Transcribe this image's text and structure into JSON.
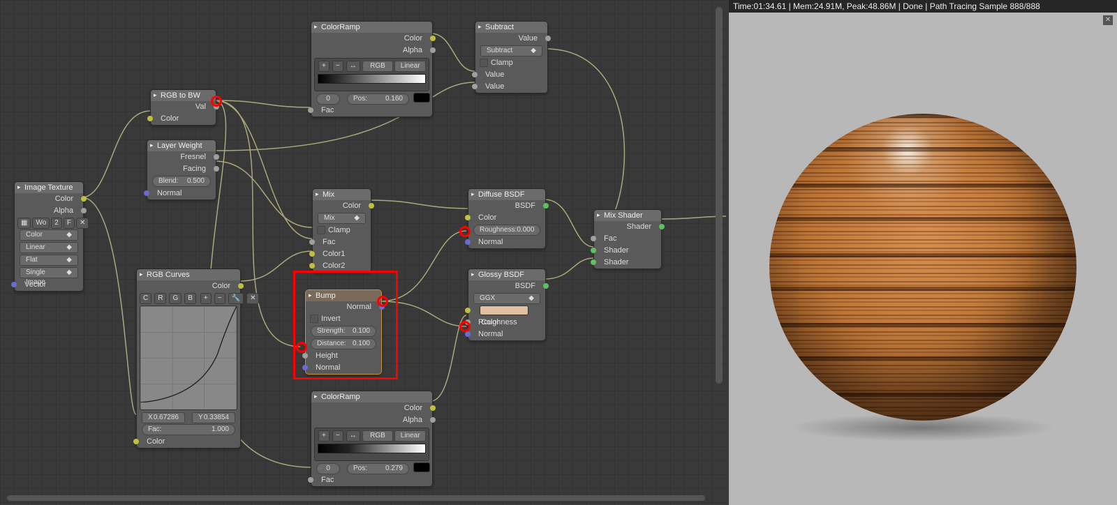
{
  "status": "Time:01:34.61 | Mem:24.91M, Peak:48.86M | Done | Path Tracing Sample 888/888",
  "imageTexture": {
    "title": "Image Texture",
    "outColor": "Color",
    "outAlpha": "Alpha",
    "imgName": "Wo",
    "btn2": "2",
    "btnF": "F",
    "colorSpace": "Color",
    "interp": "Linear",
    "proj": "Flat",
    "frame": "Single Image",
    "inVector": "Vector"
  },
  "rgbToBw": {
    "title": "RGB to BW",
    "outVal": "Val",
    "inColor": "Color"
  },
  "layerWeight": {
    "title": "Layer Weight",
    "outFresnel": "Fresnel",
    "outFacing": "Facing",
    "blendLabel": "Blend:",
    "blendVal": "0.500",
    "inNormal": "Normal"
  },
  "rgbCurves": {
    "title": "RGB Curves",
    "outColor": "Color",
    "tabs": {
      "c": "C",
      "r": "R",
      "g": "G",
      "b": "B"
    },
    "xLabel": "X",
    "xVal": "0.67286",
    "yLabel": "Y",
    "yVal": "0.33854",
    "facLabel": "Fac:",
    "facVal": "1.000",
    "inColor": "Color"
  },
  "colorRamp1": {
    "title": "ColorRamp",
    "outColor": "Color",
    "outAlpha": "Alpha",
    "mode": "RGB",
    "interp": "Linear",
    "stop": "0",
    "posLabel": "Pos:",
    "posVal": "0.160",
    "inFac": "Fac"
  },
  "colorRamp2": {
    "title": "ColorRamp",
    "outColor": "Color",
    "outAlpha": "Alpha",
    "mode": "RGB",
    "interp": "Linear",
    "stop": "0",
    "posLabel": "Pos:",
    "posVal": "0.279",
    "inFac": "Fac"
  },
  "subtract": {
    "title": "Subtract",
    "outValue": "Value",
    "op": "Subtract",
    "clamp": "Clamp",
    "inVal1": "Value",
    "inVal2": "Value"
  },
  "mix": {
    "title": "Mix",
    "outColor": "Color",
    "mode": "Mix",
    "clamp": "Clamp",
    "inFac": "Fac",
    "inColor1": "Color1",
    "inColor2": "Color2"
  },
  "bump": {
    "title": "Bump",
    "outNormal": "Normal",
    "invert": "Invert",
    "strLabel": "Strength:",
    "strVal": "0.100",
    "distLabel": "Distance:",
    "distVal": "0.100",
    "inHeight": "Height",
    "inNormal": "Normal"
  },
  "diffuse": {
    "title": "Diffuse BSDF",
    "outBSDF": "BSDF",
    "inColor": "Color",
    "roughLabel": "Roughness:",
    "roughVal": "0.000",
    "inNormal": "Normal"
  },
  "glossy": {
    "title": "Glossy BSDF",
    "outBSDF": "BSDF",
    "dist": "GGX",
    "inColor": "Color",
    "inRough": "Roughness",
    "inNormal": "Normal"
  },
  "mixShader": {
    "title": "Mix Shader",
    "outShader": "Shader",
    "inFac": "Fac",
    "inSh1": "Shader",
    "inSh2": "Shader"
  }
}
